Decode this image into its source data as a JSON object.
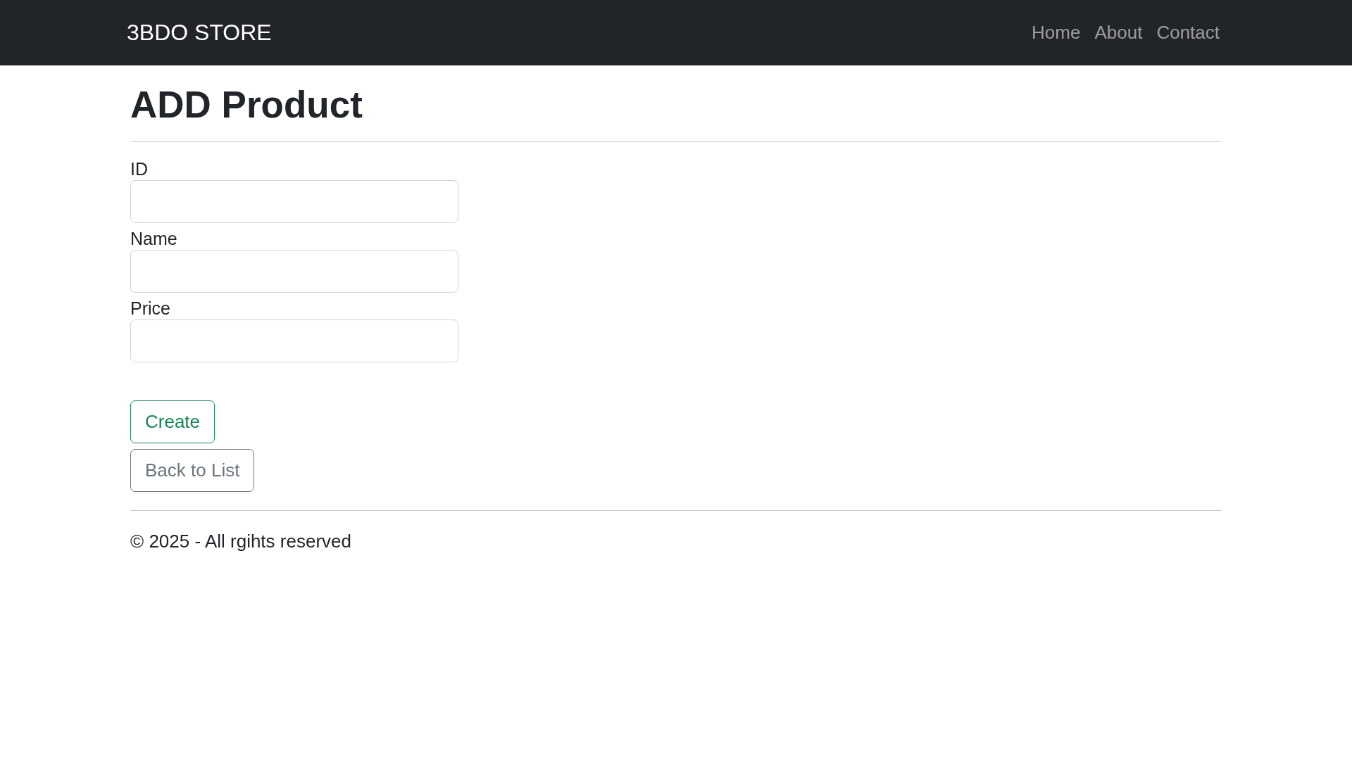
{
  "navbar": {
    "brand": "3BDO STORE",
    "links": [
      {
        "label": "Home"
      },
      {
        "label": "About"
      },
      {
        "label": "Contact"
      }
    ]
  },
  "page": {
    "title": "ADD Product"
  },
  "form": {
    "fields": [
      {
        "label": "ID"
      },
      {
        "label": "Name"
      },
      {
        "label": "Price"
      }
    ],
    "buttons": [
      {
        "label": "Create",
        "kind": "success"
      },
      {
        "label": "Back to List",
        "kind": "secondary"
      }
    ]
  },
  "footer": {
    "text": "© 2025 - All rgihts reserved"
  }
}
